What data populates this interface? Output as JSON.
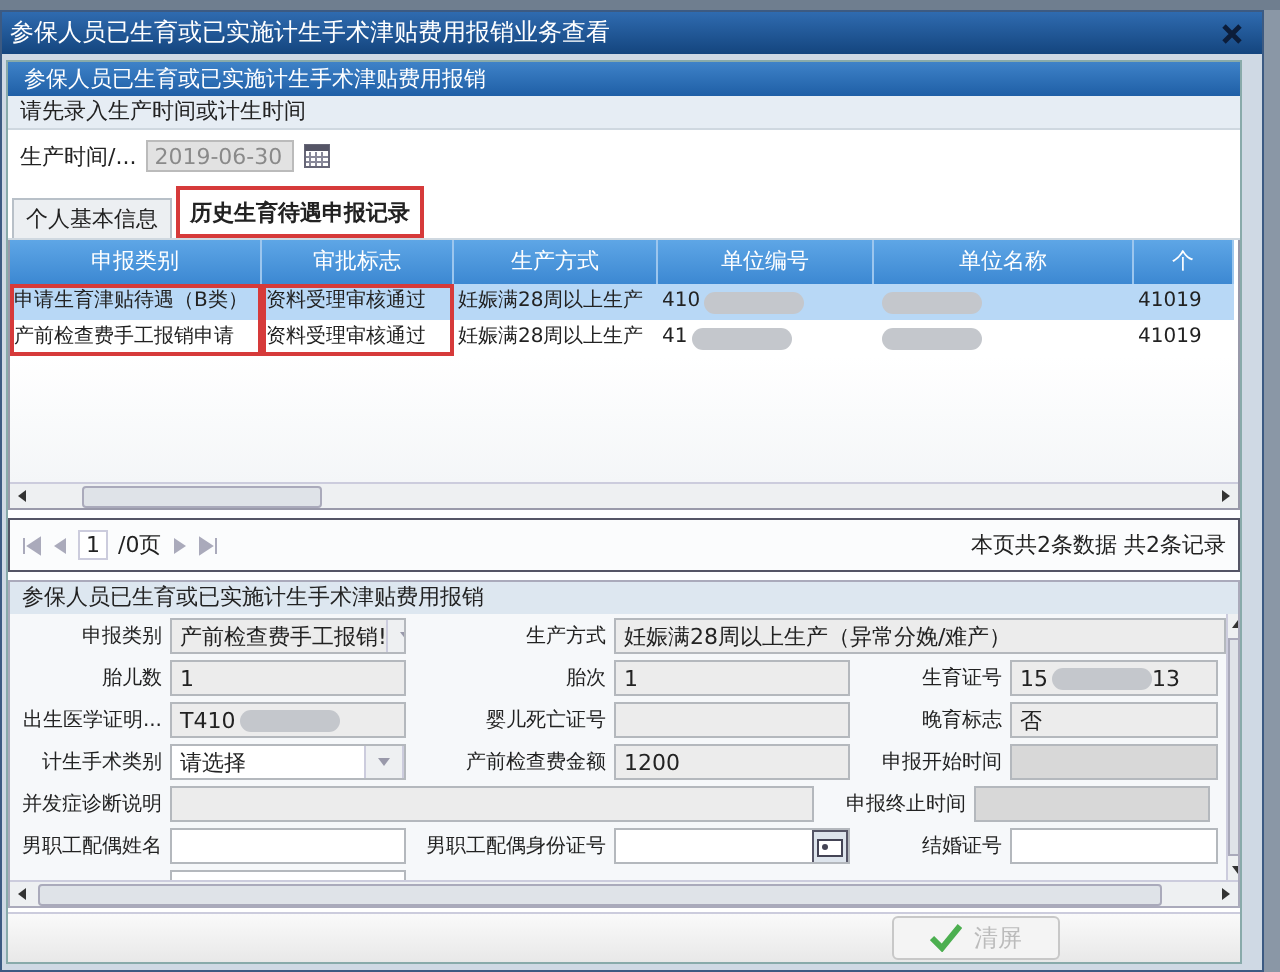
{
  "window": {
    "title": "参保人员已生育或已实施计生手术津贴费用报销业务查看"
  },
  "panel": {
    "title": "参保人员已生育或已实施计生手术津贴费用报销",
    "hint": "请先录入生产时间或计生时间",
    "date_label": "生产时间/...",
    "date_value": "2019-06-30",
    "date_disabled": true
  },
  "tabs": [
    {
      "label": "个人基本信息",
      "selected": false,
      "highlighted": false
    },
    {
      "label": "历史生育待遇申报记录",
      "selected": true,
      "highlighted": true
    }
  ],
  "table": {
    "columns": [
      {
        "label": "申报类别",
        "highlighted": true
      },
      {
        "label": "审批标志",
        "highlighted": true
      },
      {
        "label": "生产方式",
        "highlighted": false
      },
      {
        "label": "单位编号",
        "highlighted": false
      },
      {
        "label": "单位名称",
        "highlighted": false
      },
      {
        "label": "个",
        "highlighted": false
      }
    ],
    "rows": [
      {
        "selected": true,
        "cells": [
          {
            "text": "申请生育津贴待遇（B类）"
          },
          {
            "text": "资料受理审核通过"
          },
          {
            "text": "妊娠满28周以上生产"
          },
          {
            "text": "410",
            "blurred": true
          },
          {
            "blurred": true
          },
          {
            "text": "41019"
          }
        ]
      },
      {
        "selected": false,
        "cells": [
          {
            "text": "产前检查费手工报销申请"
          },
          {
            "text": "资料受理审核通过"
          },
          {
            "text": "妊娠满28周以上生产"
          },
          {
            "text": "41",
            "blurred": true
          },
          {
            "blurred": true
          },
          {
            "text": "41019"
          }
        ]
      }
    ]
  },
  "pager": {
    "page": "1",
    "total_pages": "/0页",
    "summary": "本页共2条数据 共2条记录"
  },
  "form": {
    "title": "参保人员已生育或已实施计生手术津贴费用报销",
    "rows": [
      [
        {
          "label": "申报类别",
          "kind": "select",
          "value": "产前检查费手工报销!",
          "disabled": true
        },
        {
          "label": "生产方式",
          "kind": "text",
          "value": "妊娠满28周以上生产（异常分娩/难产）",
          "disabled": true,
          "wide": true
        }
      ],
      [
        {
          "label": "胎儿数",
          "kind": "text",
          "value": "1",
          "disabled": true
        },
        {
          "label": "胎次",
          "kind": "text",
          "value": "1",
          "disabled": true
        },
        {
          "label": "生育证号",
          "kind": "text",
          "value": "15",
          "blurred": true,
          "value_end": "13",
          "disabled": true
        }
      ],
      [
        {
          "label": "出生医学证明...",
          "kind": "text",
          "value": "T410",
          "blurred": true,
          "disabled": true
        },
        {
          "label": "婴儿死亡证号",
          "kind": "text",
          "disabled": true
        },
        {
          "label": "晚育标志",
          "kind": "text",
          "value": "否",
          "disabled": true
        }
      ],
      [
        {
          "label": "计生手术类别",
          "kind": "select",
          "value": "请选择",
          "disabled": false
        },
        {
          "label": "产前检查费金额",
          "kind": "text",
          "value": "1200",
          "disabled": true
        },
        {
          "label": "申报开始时间",
          "kind": "text",
          "disabled": true,
          "dark": true
        }
      ],
      [
        {
          "label": "并发症诊断说明",
          "kind": "text",
          "disabled": true,
          "wide": true
        },
        {
          "label": "申报终止时间",
          "kind": "text",
          "disabled": true,
          "dark": true
        }
      ],
      [
        {
          "label": "男职工配偶姓名",
          "kind": "text",
          "disabled": false
        },
        {
          "label": "男职工配偶身份证号",
          "kind": "picker",
          "disabled": false
        },
        {
          "label": "结婚证号",
          "kind": "text",
          "disabled": false
        }
      ]
    ]
  },
  "footer": {
    "clear_button": {
      "label": "清屏",
      "disabled": true
    }
  }
}
